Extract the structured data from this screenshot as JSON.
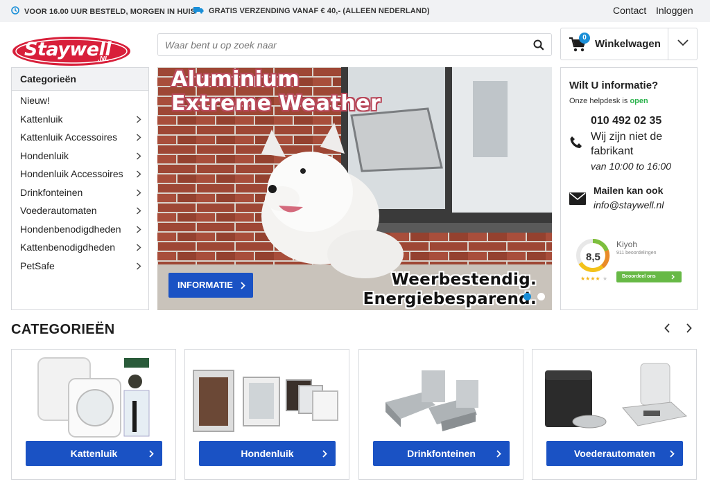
{
  "topbar": {
    "usp1": "VOOR 16.00 UUR BESTELD, MORGEN IN HUIS",
    "usp2": "GRATIS VERZENDING VANAF € 40,- (ALLEEN NEDERLAND)",
    "contact": "Contact",
    "login": "Inloggen"
  },
  "header": {
    "logo_text": "Staywell",
    "logo_suffix": ".NL",
    "search_placeholder": "Waar bent u op zoek naar",
    "cart_label": "Winkelwagen",
    "cart_count": "0"
  },
  "sidebar": {
    "title": "Categorieën",
    "items": [
      {
        "label": "Nieuw!",
        "has_children": false
      },
      {
        "label": "Kattenluik",
        "has_children": true
      },
      {
        "label": "Kattenluik Accessoires",
        "has_children": true
      },
      {
        "label": "Hondenluik",
        "has_children": true
      },
      {
        "label": "Hondenluik Accessoires",
        "has_children": true
      },
      {
        "label": "Drinkfonteinen",
        "has_children": true
      },
      {
        "label": "Voederautomaten",
        "has_children": true
      },
      {
        "label": "Hondenbenodigdheden",
        "has_children": true
      },
      {
        "label": "Kattenbenodigdheden",
        "has_children": true
      },
      {
        "label": "PetSafe",
        "has_children": true
      }
    ]
  },
  "banner": {
    "title_line1": "Aluminium",
    "title_line2": "Extreme Weather",
    "tag_line1": "Weerbestendig.",
    "tag_line2": "Energiebesparend.",
    "button": "INFORMATIE",
    "slides": 2,
    "active_slide": 1
  },
  "info": {
    "title": "Wilt U informatie?",
    "helpdesk_prefix": "Onze helpdesk is",
    "helpdesk_status": "open",
    "phone": "010 492 02 35",
    "phone_note": "Wij zijn niet de fabrikant",
    "hours": "van 10:00 to 16:00",
    "mail_heading": "Mailen kan ook",
    "mail": "info@staywell.nl",
    "kiyoh": {
      "name": "Kiyoh",
      "count": "911 beoordelingen",
      "score": "8,5",
      "button": "Beoordeel ons"
    }
  },
  "categories": {
    "title": "CATEGORIEËN",
    "items": [
      {
        "label": "Kattenluik"
      },
      {
        "label": "Hondenluik"
      },
      {
        "label": "Drinkfonteinen"
      },
      {
        "label": "Voederautomaten"
      }
    ]
  },
  "colors": {
    "brand_red": "#d81f3a",
    "button_blue": "#1a52c4",
    "badge_blue": "#1a8fd8",
    "open_green": "#2bb24c",
    "kiyoh_green": "#67b946"
  }
}
